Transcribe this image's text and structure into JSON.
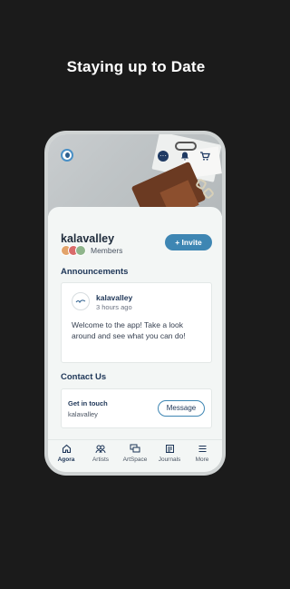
{
  "headline": "Staying up to Date",
  "site": {
    "name": "kalavalley",
    "members_label": "Members",
    "invite_label": "+ Invite"
  },
  "icons": {
    "cover_avatar": "user-avatar",
    "chat": "chat-icon",
    "bell": "bell-icon",
    "cart": "cart-icon"
  },
  "announcements": {
    "title": "Announcements",
    "post": {
      "author": "kalavalley",
      "time": "3 hours ago",
      "body": "Welcome to the app! Take a look around and see what you can do!"
    }
  },
  "contact": {
    "title": "Contact Us",
    "card_title": "Get in touch",
    "card_sub": "kalavalley",
    "message_label": "Message"
  },
  "nav": [
    {
      "label": "Agora",
      "icon": "home-icon",
      "active": true
    },
    {
      "label": "Artists",
      "icon": "group-icon",
      "active": false
    },
    {
      "label": "ArtSpace",
      "icon": "chat-bubbles-icon",
      "active": false
    },
    {
      "label": "Journals",
      "icon": "journal-icon",
      "active": false
    },
    {
      "label": "More",
      "icon": "menu-icon",
      "active": false
    }
  ],
  "colors": {
    "accent": "#3e86b3",
    "navy": "#1d3557",
    "background": "#1b1b1b"
  }
}
